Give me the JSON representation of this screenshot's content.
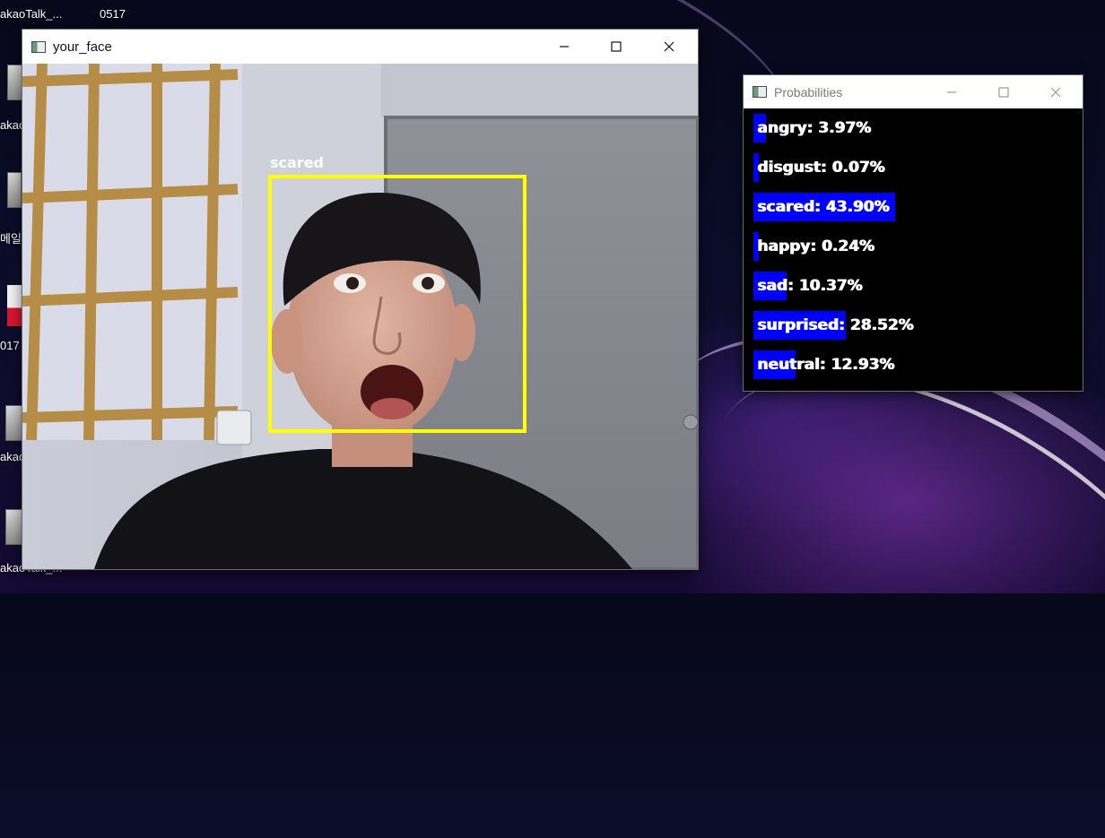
{
  "desktop": {
    "icons": [
      {
        "label": "akaoTalk_..."
      },
      {
        "label": "0517"
      },
      {
        "label": "akao"
      },
      {
        "label": "메일"
      },
      {
        "label": "017"
      },
      {
        "label": "akao"
      },
      {
        "label": "akaoTalk_..."
      }
    ]
  },
  "face_window": {
    "title": "your_face",
    "detection_label": "scared",
    "box_color": "#ffff00"
  },
  "prob_window": {
    "title": "Probabilities",
    "bar_color": "#0000ff",
    "emotions": [
      {
        "label": "angry: 3.97%",
        "probability": 3.97
      },
      {
        "label": "disgust: 0.07%",
        "probability": 0.07
      },
      {
        "label": "scared: 43.90%",
        "probability": 43.9
      },
      {
        "label": "happy: 0.24%",
        "probability": 0.24
      },
      {
        "label": "sad: 10.37%",
        "probability": 10.37
      },
      {
        "label": "surprised: 28.52%",
        "probability": 28.52
      },
      {
        "label": "neutral: 12.93%",
        "probability": 12.93
      }
    ]
  },
  "controls": {
    "minimize": "minimize-icon",
    "maximize": "maximize-icon",
    "close": "close-icon"
  }
}
